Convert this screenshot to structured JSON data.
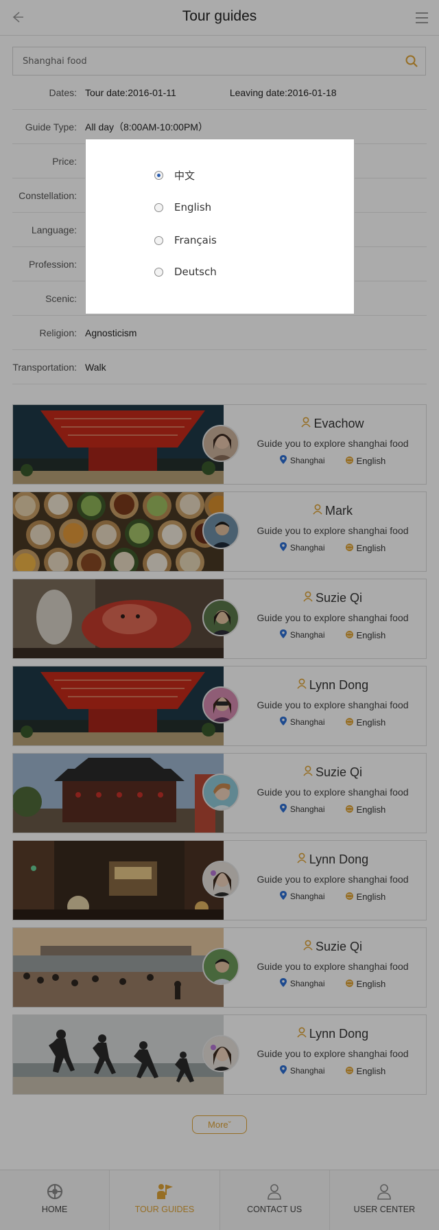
{
  "header": {
    "title": "Tour guides"
  },
  "search": {
    "value": "Shanghai food"
  },
  "filters": {
    "dates": {
      "label": "Dates:",
      "tour_date": "Tour date:2016-01-11",
      "leaving_date": "Leaving date:2016-01-18"
    },
    "guide_type": {
      "label": "Guide Type:",
      "value": "All day（8:00AM-10:00PM）"
    },
    "price": {
      "label": "Price:"
    },
    "constellation": {
      "label": "Constellation:"
    },
    "language": {
      "label": "Language:"
    },
    "profession": {
      "label": "Profession:"
    },
    "scenic": {
      "label": "Scenic:"
    },
    "religion": {
      "label": "Religion:",
      "value": "Agnosticism"
    },
    "transportation": {
      "label": "Transportation:",
      "value": "Walk"
    }
  },
  "language_modal": {
    "selected": "中文",
    "options": [
      "中文",
      "English",
      "Français",
      "Deutsch"
    ]
  },
  "guides": [
    {
      "name": "Evachow",
      "tagline": "Guide you to explore shanghai food",
      "location": "Shanghai",
      "language": "English",
      "photo": "expo-pavilion"
    },
    {
      "name": "Mark",
      "tagline": "Guide you to explore shanghai food",
      "location": "Shanghai",
      "language": "English",
      "photo": "dim-sum"
    },
    {
      "name": "Suzie Qi",
      "tagline": "Guide you to explore shanghai food",
      "location": "Shanghai",
      "language": "English",
      "photo": "figurines"
    },
    {
      "name": "Lynn Dong",
      "tagline": "Guide you to explore shanghai food",
      "location": "Shanghai",
      "language": "English",
      "photo": "expo-pavilion"
    },
    {
      "name": "Suzie Qi",
      "tagline": "Guide you to explore shanghai food",
      "location": "Shanghai",
      "language": "English",
      "photo": "chinese-pavilion"
    },
    {
      "name": "Lynn Dong",
      "tagline": "Guide you to explore shanghai food",
      "location": "Shanghai",
      "language": "English",
      "photo": "night-street-tram"
    },
    {
      "name": "Suzie Qi",
      "tagline": "Guide you to explore shanghai food",
      "location": "Shanghai",
      "language": "English",
      "photo": "riverside-sunset"
    },
    {
      "name": "Lynn Dong",
      "tagline": "Guide you to explore shanghai food",
      "location": "Shanghai",
      "language": "English",
      "photo": "beach-jumping"
    }
  ],
  "more_label": "Moreˇ",
  "tabbar": [
    {
      "label": "HOME",
      "icon": "home-icon"
    },
    {
      "label": "TOUR GUIDES",
      "icon": "flag-icon",
      "active": true
    },
    {
      "label": "CONTACT US",
      "icon": "person-icon"
    },
    {
      "label": "USER CENTER",
      "icon": "user-icon"
    }
  ],
  "colors": {
    "accent": "#e0a437",
    "location_pin": "#2c6fd6",
    "overlay": "rgba(0,0,0,0.33)"
  }
}
